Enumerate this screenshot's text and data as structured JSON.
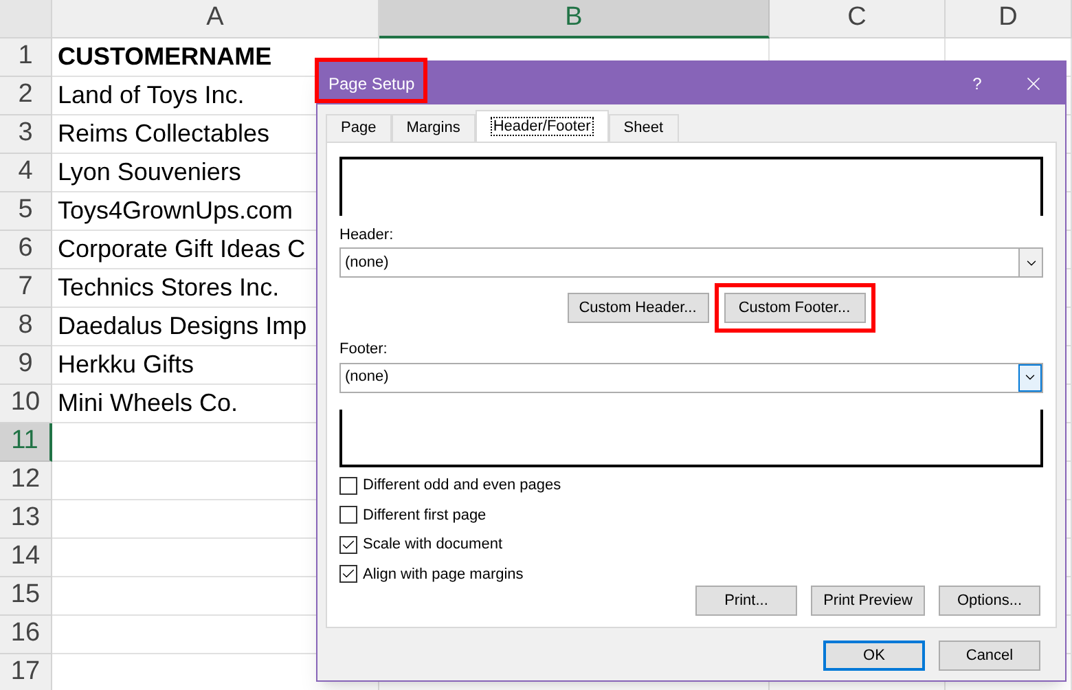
{
  "sheet": {
    "columns": [
      {
        "label": "A",
        "selected": false
      },
      {
        "label": "B",
        "selected": true
      },
      {
        "label": "C",
        "selected": false
      },
      {
        "label": "D",
        "selected": false
      }
    ],
    "rows": [
      {
        "number": "1",
        "selected": false,
        "kind": "heading",
        "cells": [
          "CUSTOMERNAME"
        ]
      },
      {
        "number": "2",
        "selected": false,
        "kind": "data",
        "cells": [
          "Land of Toys Inc."
        ]
      },
      {
        "number": "3",
        "selected": false,
        "kind": "data",
        "cells": [
          "Reims Collectables"
        ]
      },
      {
        "number": "4",
        "selected": false,
        "kind": "data",
        "cells": [
          "Lyon Souveniers"
        ]
      },
      {
        "number": "5",
        "selected": false,
        "kind": "data",
        "cells": [
          "Toys4GrownUps.com"
        ]
      },
      {
        "number": "6",
        "selected": false,
        "kind": "data",
        "cells": [
          "Corporate Gift Ideas C"
        ]
      },
      {
        "number": "7",
        "selected": false,
        "kind": "data",
        "cells": [
          "Technics Stores Inc."
        ]
      },
      {
        "number": "8",
        "selected": false,
        "kind": "data",
        "cells": [
          "Daedalus Designs Imp"
        ]
      },
      {
        "number": "9",
        "selected": false,
        "kind": "data",
        "cells": [
          "Herkku Gifts"
        ]
      },
      {
        "number": "10",
        "selected": false,
        "kind": "data",
        "cells": [
          "Mini Wheels Co."
        ]
      },
      {
        "number": "11",
        "selected": true,
        "cells": []
      },
      {
        "number": "12",
        "selected": false,
        "cells": []
      },
      {
        "number": "13",
        "selected": false,
        "cells": []
      },
      {
        "number": "14",
        "selected": false,
        "cells": []
      },
      {
        "number": "15",
        "selected": false,
        "cells": []
      },
      {
        "number": "16",
        "selected": false,
        "cells": []
      },
      {
        "number": "17",
        "selected": false,
        "cells": []
      }
    ]
  },
  "dialog": {
    "title": "Page Setup",
    "title_highlighted": true,
    "help": "?",
    "tabs": [
      {
        "label": "Page",
        "selected": false
      },
      {
        "label": "Margins",
        "selected": false
      },
      {
        "label": "Header/Footer",
        "selected": true
      },
      {
        "label": "Sheet",
        "selected": false
      }
    ],
    "header": {
      "label": "Header:",
      "value": "(none)",
      "focused": false
    },
    "custom_buttons": [
      {
        "label": "Custom Header...",
        "highlighted": false
      },
      {
        "label": "Custom Footer...",
        "highlighted": true
      }
    ],
    "footer": {
      "label": "Footer:",
      "value": "(none)",
      "focused": true
    },
    "checkboxes": [
      {
        "label": "Different odd and even pages",
        "checked": false
      },
      {
        "label": "Different first page",
        "checked": false
      },
      {
        "label": "Scale with document",
        "checked": true
      },
      {
        "label": "Align with page margins",
        "checked": true
      }
    ],
    "action_buttons": [
      "Print...",
      "Print Preview",
      "Options..."
    ],
    "buttons": [
      {
        "label": "OK",
        "default": true
      },
      {
        "label": "Cancel",
        "default": false
      }
    ]
  }
}
